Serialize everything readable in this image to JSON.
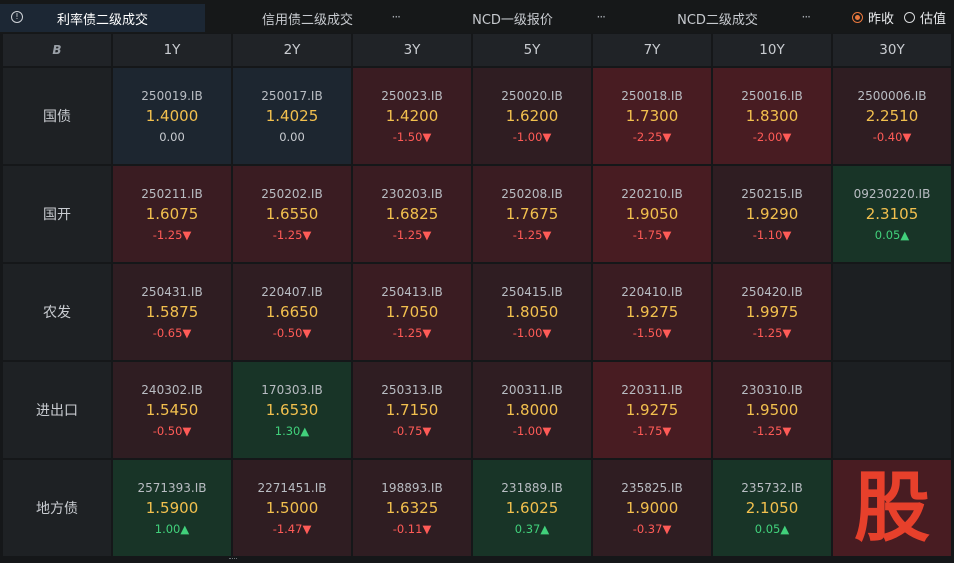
{
  "tabs": [
    {
      "label": "利率债二级成交",
      "active": true,
      "info_icon": true
    },
    {
      "label": "信用债二级成交",
      "active": false
    },
    {
      "label": "NCD一级报价",
      "active": false
    },
    {
      "label": "NCD二级成交",
      "active": false
    }
  ],
  "more_glyph": "···",
  "info_glyph": "!",
  "radio": [
    {
      "label": "昨收",
      "checked": true
    },
    {
      "label": "估值",
      "checked": false
    }
  ],
  "corner_logo": "B",
  "tenors": [
    "1Y",
    "2Y",
    "3Y",
    "5Y",
    "7Y",
    "10Y",
    "30Y"
  ],
  "rows": [
    {
      "label": "国债",
      "cells": [
        {
          "code": "250019.IB",
          "yield": "1.4000",
          "chg": "0.00",
          "dir": "flat",
          "bg": "navy"
        },
        {
          "code": "250017.IB",
          "yield": "1.4025",
          "chg": "0.00",
          "dir": "flat",
          "bg": "navy"
        },
        {
          "code": "250023.IB",
          "yield": "1.4200",
          "chg": "-1.50▼",
          "dir": "down",
          "bg": "red2"
        },
        {
          "code": "250020.IB",
          "yield": "1.6200",
          "chg": "-1.00▼",
          "dir": "down",
          "bg": "red1"
        },
        {
          "code": "250018.IB",
          "yield": "1.7300",
          "chg": "-2.25▼",
          "dir": "down",
          "bg": "red3"
        },
        {
          "code": "250016.IB",
          "yield": "1.8300",
          "chg": "-2.00▼",
          "dir": "down",
          "bg": "red3"
        },
        {
          "code": "2500006.IB",
          "yield": "2.2510",
          "chg": "-0.40▼",
          "dir": "down",
          "bg": "red1"
        }
      ]
    },
    {
      "label": "国开",
      "cells": [
        {
          "code": "250211.IB",
          "yield": "1.6075",
          "chg": "-1.25▼",
          "dir": "down",
          "bg": "red2"
        },
        {
          "code": "250202.IB",
          "yield": "1.6550",
          "chg": "-1.25▼",
          "dir": "down",
          "bg": "red2"
        },
        {
          "code": "230203.IB",
          "yield": "1.6825",
          "chg": "-1.25▼",
          "dir": "down",
          "bg": "red2"
        },
        {
          "code": "250208.IB",
          "yield": "1.7675",
          "chg": "-1.25▼",
          "dir": "down",
          "bg": "red2"
        },
        {
          "code": "220210.IB",
          "yield": "1.9050",
          "chg": "-1.75▼",
          "dir": "down",
          "bg": "red3"
        },
        {
          "code": "250215.IB",
          "yield": "1.9290",
          "chg": "-1.10▼",
          "dir": "down",
          "bg": "red1"
        },
        {
          "code": "09230220.IB",
          "yield": "2.3105",
          "chg": "0.05▲",
          "dir": "up",
          "bg": "green"
        }
      ]
    },
    {
      "label": "农发",
      "cells": [
        {
          "code": "250431.IB",
          "yield": "1.5875",
          "chg": "-0.65▼",
          "dir": "down",
          "bg": "red1"
        },
        {
          "code": "220407.IB",
          "yield": "1.6650",
          "chg": "-0.50▼",
          "dir": "down",
          "bg": "red1"
        },
        {
          "code": "250413.IB",
          "yield": "1.7050",
          "chg": "-1.25▼",
          "dir": "down",
          "bg": "red2"
        },
        {
          "code": "250415.IB",
          "yield": "1.8050",
          "chg": "-1.00▼",
          "dir": "down",
          "bg": "red1"
        },
        {
          "code": "220410.IB",
          "yield": "1.9275",
          "chg": "-1.50▼",
          "dir": "down",
          "bg": "red2"
        },
        {
          "code": "250420.IB",
          "yield": "1.9975",
          "chg": "-1.25▼",
          "dir": "down",
          "bg": "red2"
        },
        {
          "code": "",
          "yield": "",
          "chg": "",
          "dir": "flat",
          "bg": "empty"
        }
      ]
    },
    {
      "label": "进出口",
      "cells": [
        {
          "code": "240302.IB",
          "yield": "1.5450",
          "chg": "-0.50▼",
          "dir": "down",
          "bg": "red1"
        },
        {
          "code": "170303.IB",
          "yield": "1.6530",
          "chg": "1.30▲",
          "dir": "up",
          "bg": "green"
        },
        {
          "code": "250313.IB",
          "yield": "1.7150",
          "chg": "-0.75▼",
          "dir": "down",
          "bg": "red1"
        },
        {
          "code": "200311.IB",
          "yield": "1.8000",
          "chg": "-1.00▼",
          "dir": "down",
          "bg": "red1"
        },
        {
          "code": "220311.IB",
          "yield": "1.9275",
          "chg": "-1.75▼",
          "dir": "down",
          "bg": "red3"
        },
        {
          "code": "230310.IB",
          "yield": "1.9500",
          "chg": "-1.25▼",
          "dir": "down",
          "bg": "red2"
        },
        {
          "code": "",
          "yield": "",
          "chg": "",
          "dir": "flat",
          "bg": "empty"
        }
      ]
    },
    {
      "label": "地方债",
      "cells": [
        {
          "code": "2571393.IB",
          "yield": "1.5900",
          "chg": "1.00▲",
          "dir": "up",
          "bg": "green"
        },
        {
          "code": "2271451.IB",
          "yield": "1.5000",
          "chg": "-1.47▼",
          "dir": "down",
          "bg": "red1"
        },
        {
          "code": "198893.IB",
          "yield": "1.6325",
          "chg": "-0.11▼",
          "dir": "down",
          "bg": "red1"
        },
        {
          "code": "231889.IB",
          "yield": "1.6025",
          "chg": "0.37▲",
          "dir": "up",
          "bg": "green"
        },
        {
          "code": "235825.IB",
          "yield": "1.9000",
          "chg": "-0.37▼",
          "dir": "down",
          "bg": "red1"
        },
        {
          "code": "235732.IB",
          "yield": "2.1050",
          "chg": "0.05▲",
          "dir": "up",
          "bg": "green"
        },
        {
          "code": "",
          "yield": "",
          "chg": "",
          "dir": "flat",
          "bg": "red3",
          "watermark": "股"
        }
      ]
    }
  ],
  "colors": {
    "accent": "#e8773d",
    "yield": "#f2c04e",
    "down": "#ff5b57",
    "up": "#41d07b",
    "watermark": "#f0422c"
  }
}
